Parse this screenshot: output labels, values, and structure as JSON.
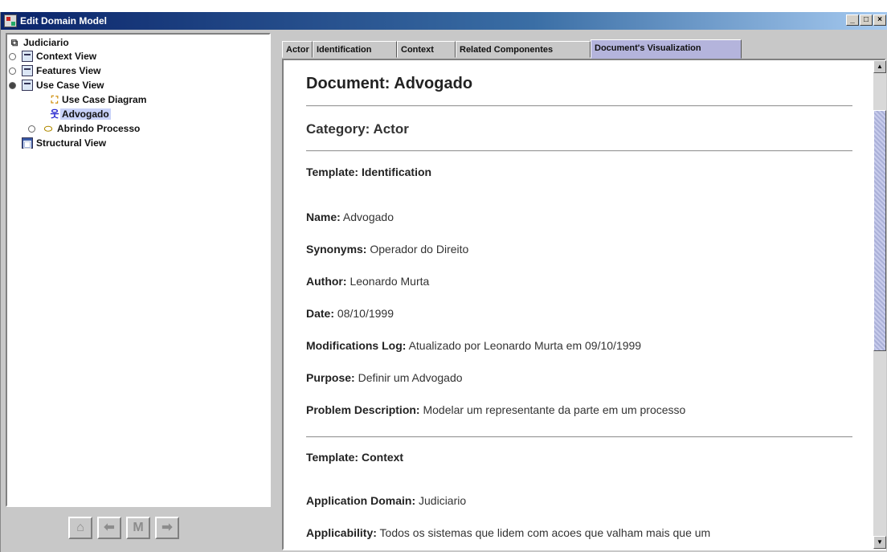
{
  "window": {
    "title": "Edit Domain Model",
    "controls": [
      "_",
      "□",
      "×"
    ]
  },
  "tree": {
    "root": "Judiciario",
    "items": [
      {
        "label": "Context View",
        "icon": "view-icon",
        "handle": "collapsed"
      },
      {
        "label": "Features View",
        "icon": "view-icon",
        "handle": "collapsed"
      },
      {
        "label": "Use Case View",
        "icon": "view-icon",
        "handle": "expanded"
      },
      {
        "label": "Use Case Diagram",
        "icon": "diagram-icon"
      },
      {
        "label": "Advogado",
        "icon": "actor-icon",
        "selected": true
      },
      {
        "label": "Abrindo Processo",
        "icon": "use-case-icon",
        "handle": "collapsed"
      },
      {
        "label": "Structural View",
        "icon": "structural-view-icon"
      }
    ]
  },
  "nav_buttons": [
    {
      "name": "home-icon",
      "glyph": "⌂"
    },
    {
      "name": "back-arrow-icon",
      "glyph": "⬅"
    },
    {
      "name": "m-button-icon",
      "glyph": "M"
    },
    {
      "name": "forward-arrow-icon",
      "glyph": "➡"
    }
  ],
  "tabs": [
    "Actor",
    "Identification",
    "Context",
    "Related Componentes",
    "Document's Visualization"
  ],
  "document": {
    "title": "Document: Advogado",
    "category": "Category: Actor",
    "template_identification": "Template: Identification",
    "fields": [
      {
        "label": "Name:",
        "value": "Advogado"
      },
      {
        "label": "Synonyms:",
        "value": "Operador do Direito"
      },
      {
        "label": "Author:",
        "value": "Leonardo Murta"
      },
      {
        "label": "Date:",
        "value": "08/10/1999"
      },
      {
        "label": "Modifications Log:",
        "value": "Atualizado por Leonardo Murta em 09/10/1999"
      },
      {
        "label": "Purpose:",
        "value": "Definir um Advogado"
      },
      {
        "label": "Problem Description:",
        "value": "Modelar um representante da parte em um processo"
      }
    ],
    "template_context": "Template: Context",
    "context_fields": [
      {
        "label": "Application Domain:",
        "value": "Judiciario"
      },
      {
        "label": "Applicability:",
        "value": "Todos os sistemas que lidem com acoes que valham mais que um"
      }
    ]
  }
}
